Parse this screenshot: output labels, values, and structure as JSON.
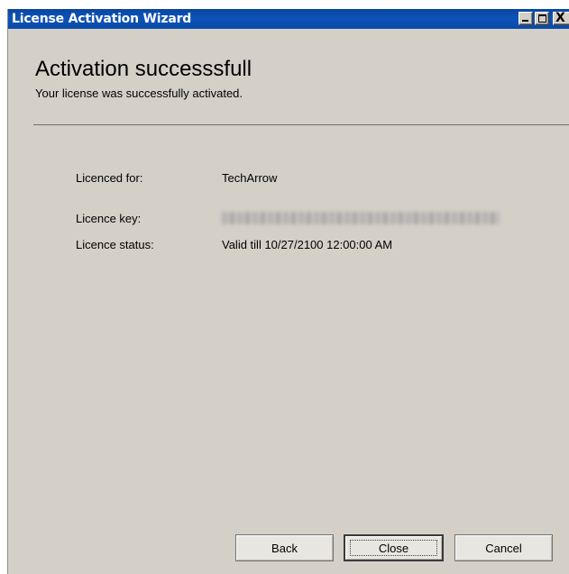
{
  "window": {
    "title": "License Activation Wizard",
    "controls": {
      "minimize": "minimize",
      "maximize": "maximize",
      "close": "X"
    }
  },
  "header": {
    "heading": "Activation successsfull",
    "subheading": "Your license was successfully activated."
  },
  "details": {
    "licensed_for_label": "Licenced for:",
    "licensed_for_value": "TechArrow",
    "key_label": "Licence key:",
    "status_label": "Licence status:",
    "status_value": "Valid till 10/27/2100 12:00:00 AM"
  },
  "buttons": {
    "back": "Back",
    "close": "Close",
    "cancel": "Cancel"
  },
  "colors": {
    "titlebar": "#0c53b7",
    "dialog_bg": "#d4d0c8"
  }
}
